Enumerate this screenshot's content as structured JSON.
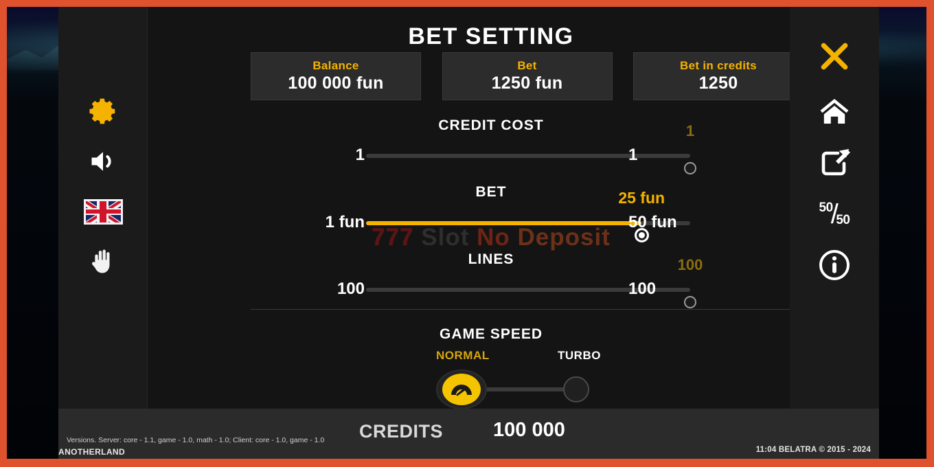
{
  "window": {
    "frame_color": "#e0522e",
    "background_color": "#050608"
  },
  "modal": {
    "title": "BET SETTING",
    "info_boxes": [
      {
        "label": "Balance",
        "value": "100 000 fun"
      },
      {
        "label": "Bet",
        "value": "1250 fun"
      },
      {
        "label": "Bet in credits",
        "value": "1250"
      }
    ],
    "sliders": [
      {
        "id": "credit-cost",
        "title": "CREDIT COST",
        "min_label": "1",
        "max_label": "1",
        "current_label": "1",
        "percent": 100,
        "active": false
      },
      {
        "id": "bet",
        "title": "BET",
        "min_label": "1 fun",
        "max_label": "50 fun",
        "current_label": "25 fun",
        "percent": 85,
        "active": true
      },
      {
        "id": "lines",
        "title": "LINES",
        "min_label": "100",
        "max_label": "100",
        "current_label": "100",
        "percent": 100,
        "active": false
      }
    ],
    "game_speed": {
      "title": "GAME SPEED",
      "normal_label": "NORMAL",
      "turbo_label": "TURBO",
      "selected": "NORMAL"
    },
    "watermark": {
      "sevens": "777",
      "word1": "Slot",
      "word2": "No",
      "word3": "Deposit"
    },
    "sidebar_left": [
      {
        "name": "gear-icon",
        "label": "Settings",
        "active": true
      },
      {
        "name": "sound-icon",
        "label": "Sound",
        "active": false
      },
      {
        "name": "flag-uk-icon",
        "label": "Language: English",
        "active": false
      },
      {
        "name": "hand-icon",
        "label": "Hand / stop",
        "active": false
      }
    ],
    "sidebar_right": [
      {
        "name": "close-icon",
        "label": "Close",
        "active": true
      },
      {
        "name": "home-icon",
        "label": "Home",
        "active": false
      },
      {
        "name": "share-icon",
        "label": "Open in new window",
        "active": false
      },
      {
        "name": "fifty-fifty-icon",
        "label": "50/50",
        "top": "50",
        "bottom": "50",
        "active": false
      },
      {
        "name": "info-icon",
        "label": "Info",
        "active": false
      }
    ]
  },
  "footer": {
    "credits_label": "CREDITS",
    "credits_value": "100 000",
    "versions": "Versions. Server: core - 1.1, game - 1.0, math - 1.0; Client: core - 1.0, game - 1.0",
    "brand": "ANOTHERLAND",
    "clock_copyright": "11:04  BELATRA © 2015 - 2024"
  },
  "colors": {
    "accent_gold": "#f5b300",
    "frame_orange": "#e0522e",
    "panel_dark": "#161616",
    "info_box": "#2c2c2c"
  }
}
